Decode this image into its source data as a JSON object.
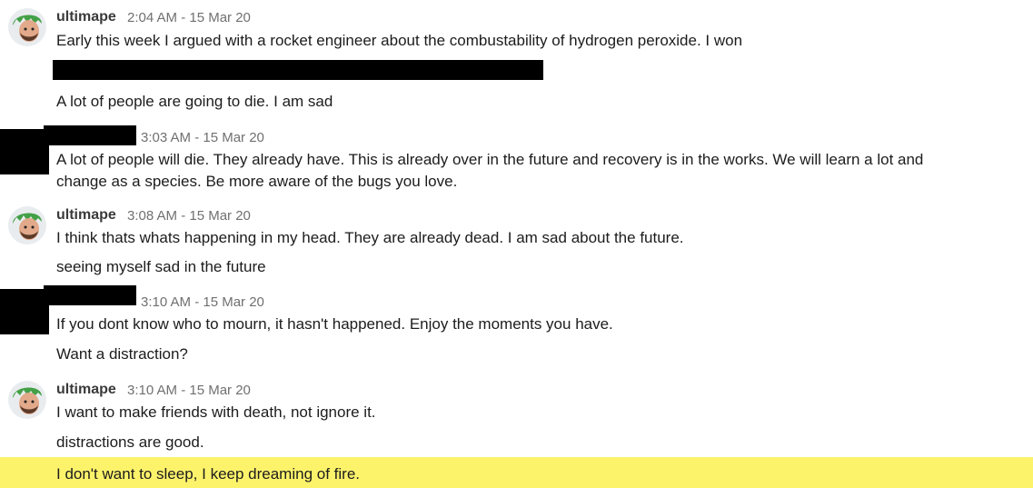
{
  "messages": [
    {
      "author": "ultimape",
      "time": "2:04 AM - 15 Mar 20",
      "lines": [
        "Early this week I argued with a rocket engineer about the combustability of hydrogen peroxide. I won",
        "A lot of people are going to die. I am sad"
      ]
    },
    {
      "author": "",
      "time": "3:03 AM - 15 Mar 20",
      "lines": [
        "A lot of people will die. They already have. This is already over in the future and recovery is in the works. We will learn a lot and",
        "change as a species. Be more aware of the bugs you love."
      ]
    },
    {
      "author": "ultimape",
      "time": "3:08 AM - 15 Mar 20",
      "lines": [
        "I think thats whats happening in my head. They are already dead. I am sad about the future.",
        "seeing myself sad in the future"
      ]
    },
    {
      "author": "",
      "time": "3:10 AM - 15 Mar 20",
      "lines": [
        "If you dont know who to mourn, it hasn't happened. Enjoy the moments you have.",
        "Want a distraction?"
      ]
    },
    {
      "author": "ultimape",
      "time": "3:10 AM - 15 Mar 20",
      "lines": [
        "I want to make friends with death, not ignore it.",
        "distractions are good.",
        "I don't want to sleep, I keep dreaming of fire."
      ]
    }
  ],
  "colors": {
    "highlight": "#fdf36b",
    "avatar_hair": "#4caf50",
    "redaction": "#000000"
  },
  "icons": {
    "avatar": "green-haired-face-icon"
  }
}
